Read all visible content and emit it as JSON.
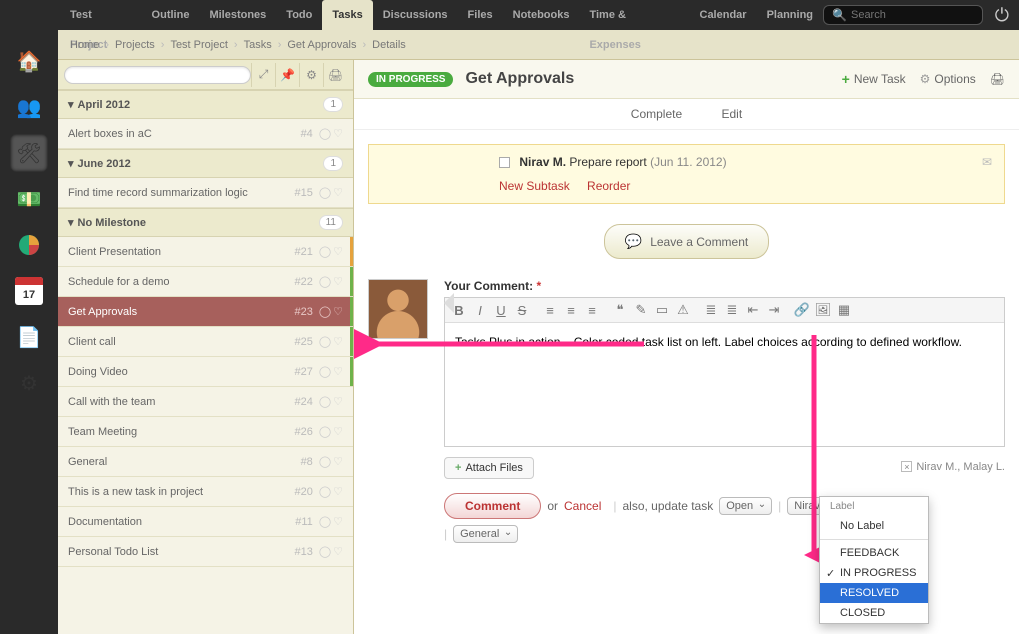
{
  "topnav": [
    "Test Project",
    "Outline",
    "Milestones",
    "Todo",
    "Tasks",
    "Discussions",
    "Files",
    "Notebooks",
    "Time & Expenses",
    "Calendar",
    "Planning"
  ],
  "topnav_active": 4,
  "search_placeholder": "Search",
  "breadcrumbs": [
    "Home",
    "Projects",
    "Test Project",
    "Tasks",
    "Get Approvals",
    "Details"
  ],
  "rail_icons": [
    "home",
    "people",
    "tools",
    "money",
    "pie",
    "calendar",
    "page",
    "gear"
  ],
  "rail_active": 2,
  "calendar_day": "17",
  "sidebar": {
    "groups": [
      {
        "label": "April 2012",
        "count": 1,
        "items": [
          {
            "title": "Alert boxes in aC",
            "num": "#4",
            "edge": ""
          }
        ]
      },
      {
        "label": "June 2012",
        "count": 1,
        "items": [
          {
            "title": "Find time record summarization logic",
            "num": "#15",
            "edge": ""
          }
        ]
      },
      {
        "label": "No Milestone",
        "count": 11,
        "items": [
          {
            "title": "Client Presentation",
            "num": "#21",
            "edge": "orange"
          },
          {
            "title": "Schedule for a demo",
            "num": "#22",
            "edge": "green"
          },
          {
            "title": "Get Approvals",
            "num": "#23",
            "edge": "green",
            "selected": true
          },
          {
            "title": "Client call",
            "num": "#25",
            "edge": "green"
          },
          {
            "title": "Doing Video",
            "num": "#27",
            "edge": "green"
          },
          {
            "title": "Call with the team",
            "num": "#24",
            "edge": ""
          },
          {
            "title": "Team Meeting",
            "num": "#26",
            "edge": ""
          },
          {
            "title": "General",
            "num": "#8",
            "edge": ""
          },
          {
            "title": "This is a new task in project",
            "num": "#20",
            "edge": ""
          },
          {
            "title": "Documentation",
            "num": "#11",
            "edge": ""
          },
          {
            "title": "Personal Todo List",
            "num": "#13",
            "edge": ""
          }
        ]
      }
    ]
  },
  "task": {
    "status": "IN PROGRESS",
    "title": "Get Approvals",
    "new_task": "New Task",
    "options": "Options",
    "tabs": [
      "Complete",
      "Edit"
    ],
    "subtask_assignee": "Nirav M.",
    "subtask_title": "Prepare report",
    "subtask_date": "(Jun 11. 2012)",
    "new_subtask": "New Subtask",
    "reorder": "Reorder",
    "leave_comment": "Leave a Comment"
  },
  "comment": {
    "label": "Your Comment:",
    "text": "Tasks Plus in action... Color coded task list on left. Label choices according to defined workflow.",
    "attach": "Attach Files",
    "subscribers": "Nirav M., Malay L.",
    "submit": "Comment",
    "or": "or",
    "cancel": "Cancel",
    "also_label": "also, update task",
    "status_sel": "Open",
    "assignee_sel": "Nirav Mehta",
    "category_sel": "General"
  },
  "dropdown": {
    "header": "Label",
    "none": "No Label",
    "items": [
      "FEEDBACK",
      "IN PROGRESS",
      "RESOLVED",
      "CLOSED"
    ],
    "checked": 1,
    "highlight": 2
  }
}
